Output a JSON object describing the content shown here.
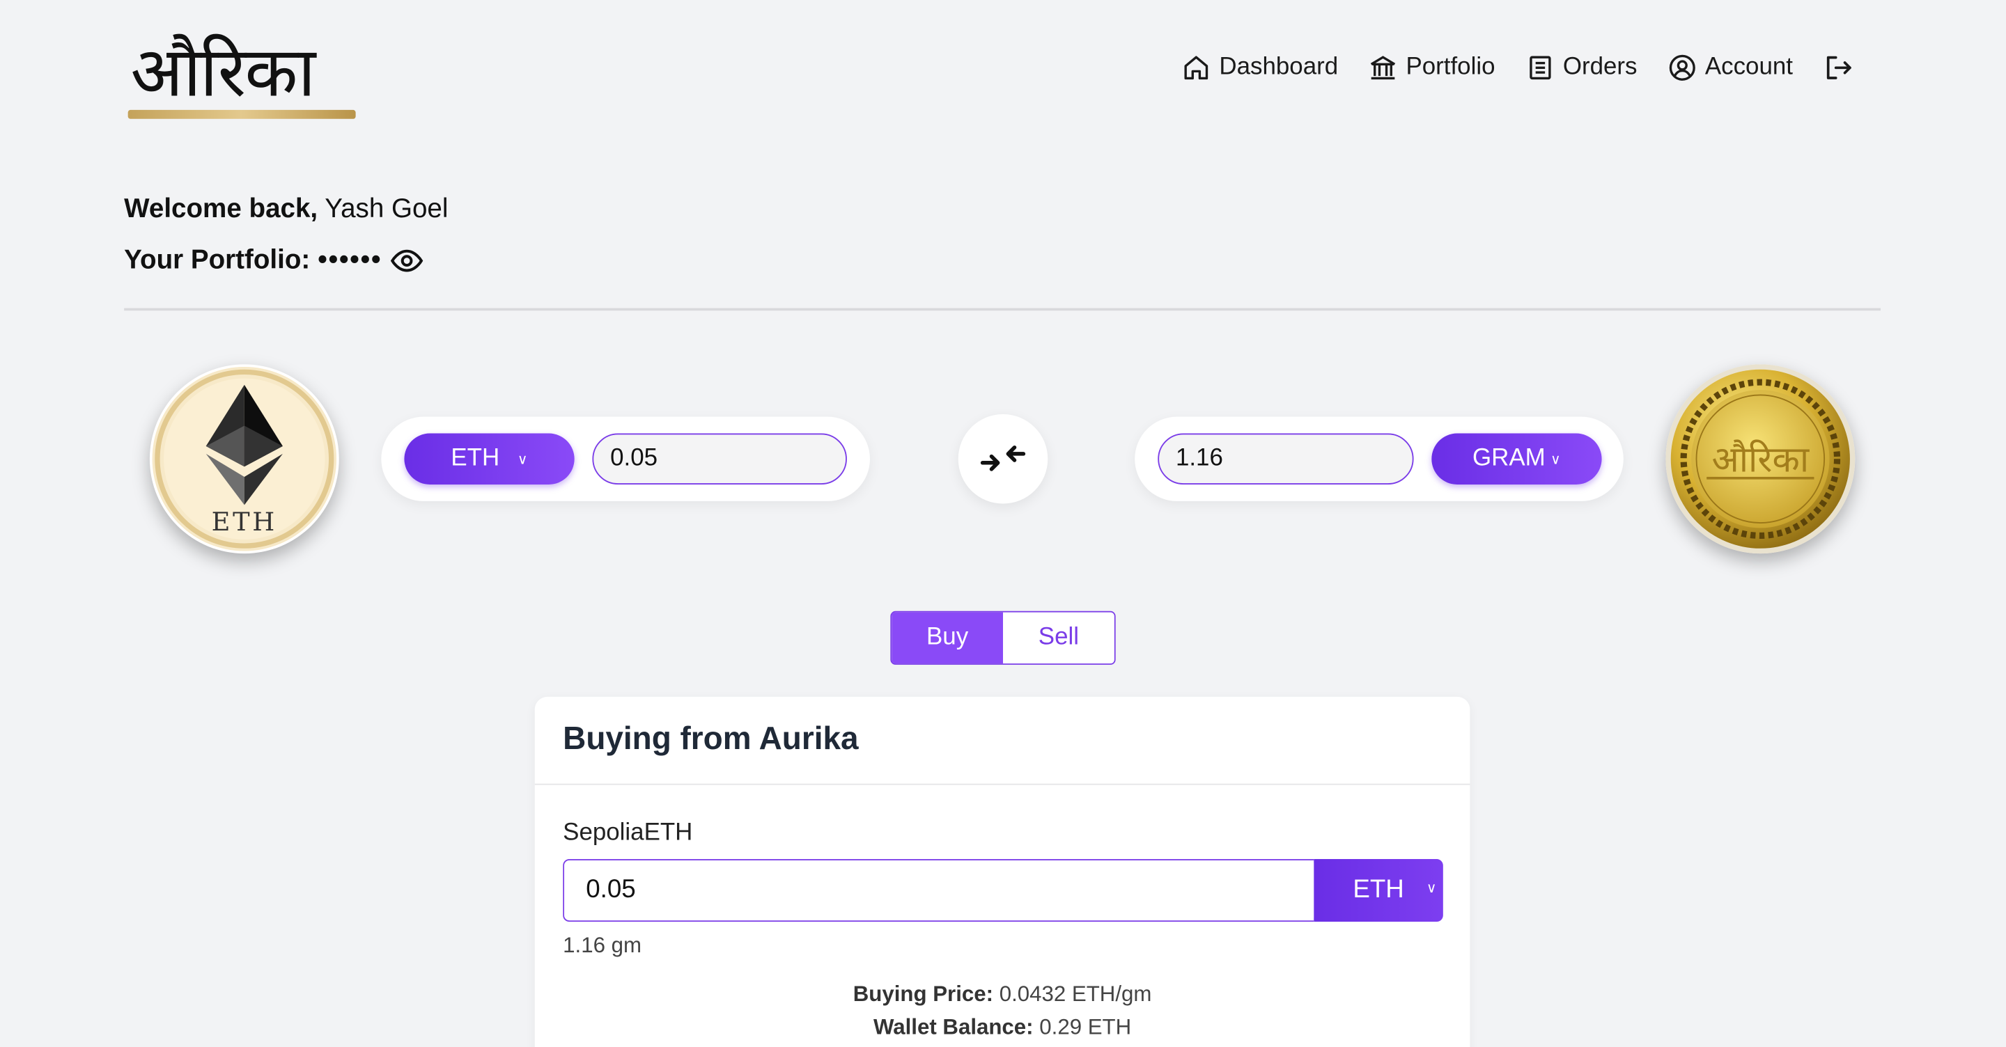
{
  "logo": {
    "text": "औरिका"
  },
  "nav": {
    "items": [
      {
        "label": "Dashboard",
        "icon": "home-icon"
      },
      {
        "label": "Portfolio",
        "icon": "bank-icon"
      },
      {
        "label": "Orders",
        "icon": "receipt-icon"
      },
      {
        "label": "Account",
        "icon": "user-circle-icon"
      }
    ],
    "logout_icon": "logout-icon"
  },
  "welcome": {
    "prefix": "Welcome back,",
    "name": "Yash Goel",
    "portfolio_label": "Your Portfolio:",
    "portfolio_masked": "••••••"
  },
  "swap": {
    "from_token": "ETH",
    "from_amount": "0.05",
    "to_amount": "1.16",
    "to_token": "GRAM",
    "eth_coin_label": "ETH",
    "gold_coin_label": "औरिका"
  },
  "toggle": {
    "buy": "Buy",
    "sell": "Sell",
    "active": "buy"
  },
  "card": {
    "title": "Buying from Aurika",
    "field_label": "SepoliaETH",
    "amount": "0.05",
    "unit": "ETH",
    "gram_note": "1.16 gm",
    "price_label": "Buying Price:",
    "price_value": "0.0432 ETH/gm",
    "balance_label": "Wallet Balance:",
    "balance_value": "0.29 ETH"
  },
  "colors": {
    "accent": "#7a3ce8",
    "accent_dark": "#6a2ee6",
    "background": "#f2f3f5",
    "gold": "#d4b44a"
  }
}
